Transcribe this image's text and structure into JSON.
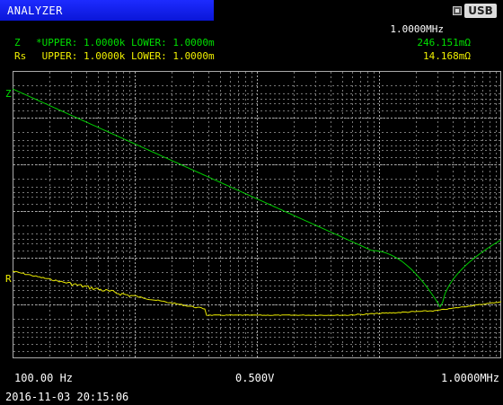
{
  "title_bar": {
    "title": "ANALYZER",
    "usb_label": "USB",
    "usb_icon": "usb-plug-icon"
  },
  "header": {
    "frequency": "1.0000MHz",
    "traces": [
      {
        "name": "Z",
        "limits": "*UPPER: 1.0000k LOWER: 1.0000m",
        "value": "246.151mΩ",
        "color": "#00e000"
      },
      {
        "name": "Rs",
        "limits": " UPPER: 1.0000k LOWER: 1.0000m",
        "value": "14.168mΩ",
        "color": "#f0f000"
      }
    ]
  },
  "plot": {
    "z_marker": "Z",
    "r_marker": "R"
  },
  "footer": {
    "start_freq": "100.00 Hz",
    "level": "0.500V",
    "stop_freq": "1.0000MHz",
    "timestamp": "2016-11-03 20:15:06"
  }
}
